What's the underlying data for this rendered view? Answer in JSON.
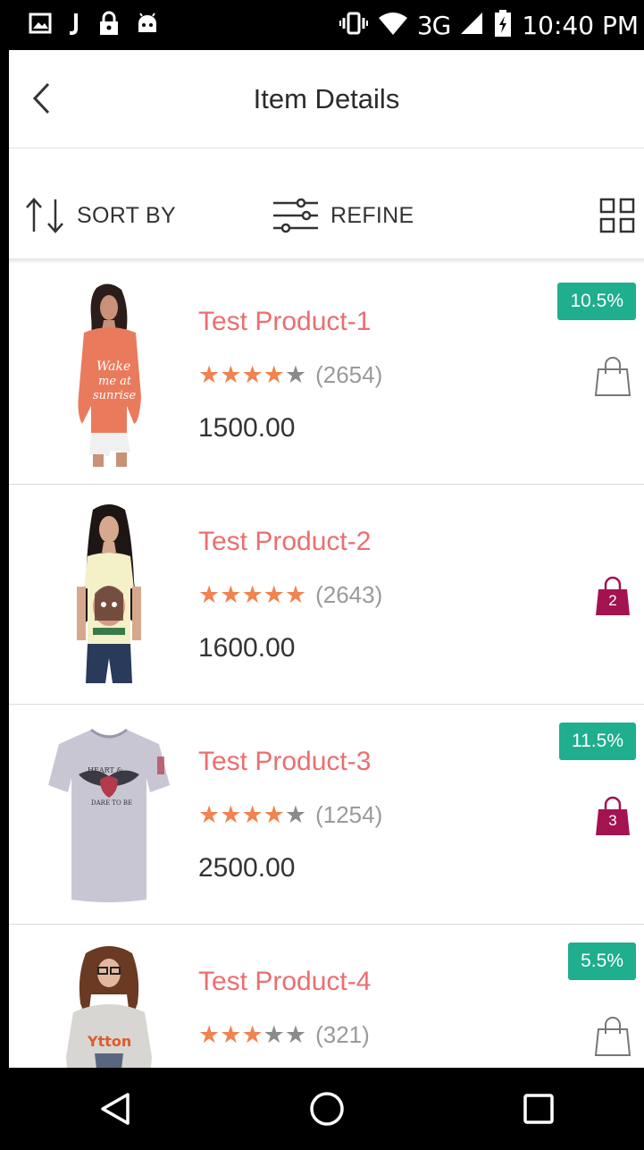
{
  "status_bar": {
    "network": "3G",
    "time": "10:40 PM",
    "icons": [
      "image-icon",
      "j-app-icon",
      "lock-icon",
      "android-icon",
      "vibrate-icon",
      "wifi-icon",
      "signal-icon",
      "battery-charging-icon"
    ]
  },
  "header": {
    "title": "Item Details",
    "back_icon": "chevron-left-icon"
  },
  "toolbar": {
    "sort_label": "SORT BY",
    "refine_label": "REFINE",
    "sort_icon": "sort-arrows-icon",
    "refine_icon": "sliders-icon",
    "view_icon": "grid-view-icon"
  },
  "products": [
    {
      "name": "Test Product-1",
      "rating": 4,
      "reviews": "(2654)",
      "price": "1500.00",
      "discount": "10.5%",
      "cart_count": "",
      "in_cart": false
    },
    {
      "name": "Test Product-2",
      "rating": 5,
      "reviews": "(2643)",
      "price": "1600.00",
      "discount": "",
      "cart_count": "2",
      "in_cart": true
    },
    {
      "name": "Test Product-3",
      "rating": 4,
      "reviews": "(1254)",
      "price": "2500.00",
      "discount": "11.5%",
      "cart_count": "3",
      "in_cart": true
    },
    {
      "name": "Test Product-4",
      "rating": 3,
      "reviews": "(321)",
      "price": "",
      "discount": "5.5%",
      "cart_count": "",
      "in_cart": false
    }
  ],
  "colors": {
    "product_name": "#ec6e6e",
    "star_on": "#f08350",
    "star_off": "#8a8a8a",
    "discount_badge": "#1fae8e",
    "bag_filled": "#a3134f"
  },
  "nav": {
    "back_icon": "triangle-back-icon",
    "home_icon": "circle-home-icon",
    "recents_icon": "square-recents-icon"
  }
}
